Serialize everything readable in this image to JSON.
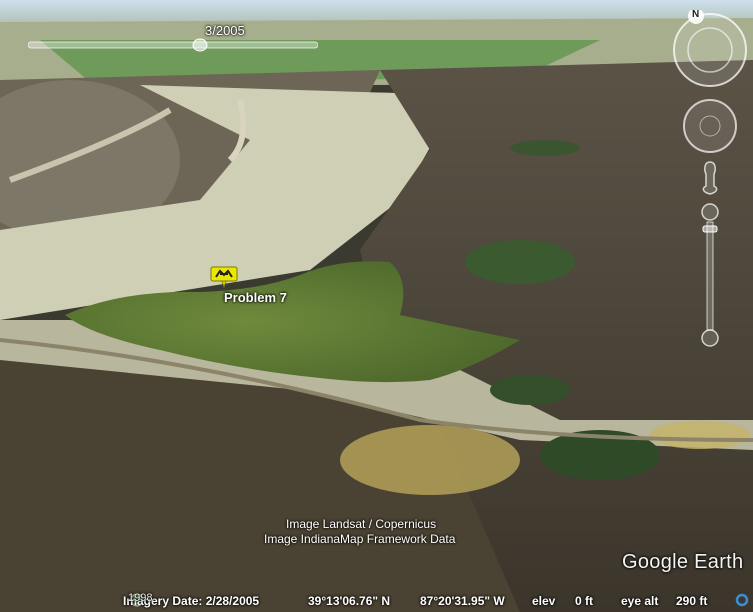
{
  "time_slider": {
    "label": "3/2005"
  },
  "placemark": {
    "label": "Problem 7",
    "icon": "hiker-pin-icon",
    "color": "#e8e800"
  },
  "credits": {
    "line1": "Image Landsat / Copernicus",
    "line2": "Image IndianaMap Framework Data"
  },
  "logo": "Google Earth",
  "status_bar": {
    "image_date": "Imagery Date: 2/28/2005",
    "historical_year": "1998",
    "latitude": "39°13'06.76\" N",
    "longitude": "87°20'31.95\" W",
    "elev_label": "elev",
    "elev_value": "0 ft",
    "eye_alt_label": "eye alt",
    "eye_alt_value": "290 ft"
  },
  "navigation": {
    "north_label": "N"
  }
}
